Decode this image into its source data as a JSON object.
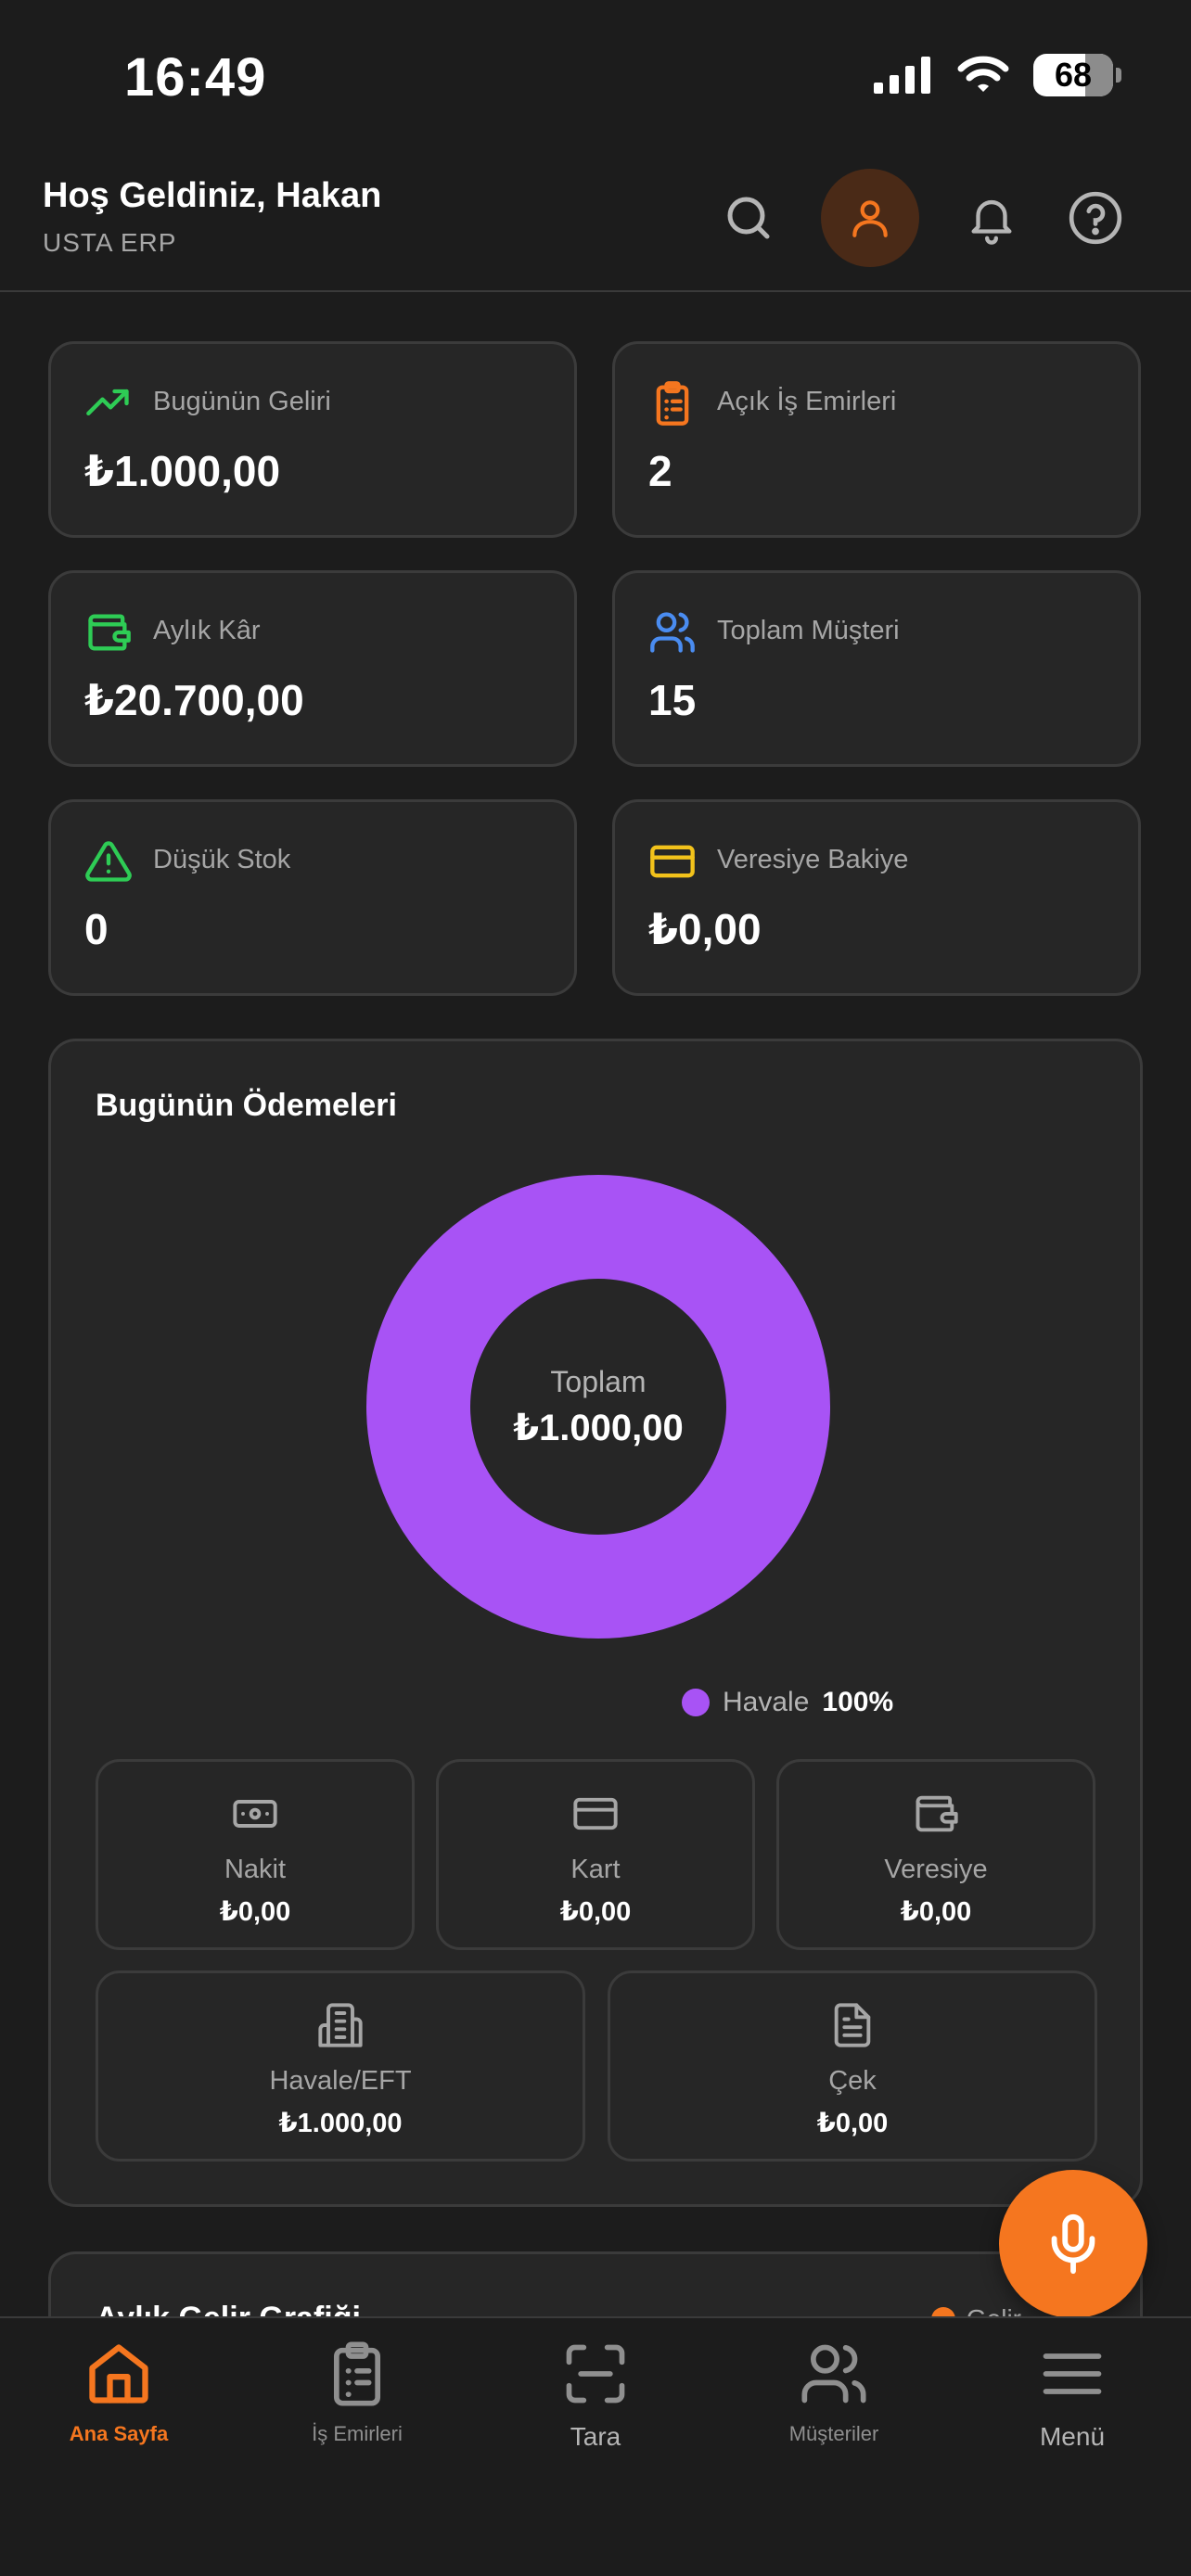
{
  "status_bar": {
    "time": "16:49",
    "battery": "68"
  },
  "header": {
    "greeting": "Hoş Geldiniz, Hakan",
    "company": "USTA ERP"
  },
  "stats": [
    {
      "label": "Bugünün Geliri",
      "value": "₺1.000,00",
      "icon": "trending-up-icon",
      "color": "#2ecc55"
    },
    {
      "label": "Açık İş Emirleri",
      "value": "2",
      "icon": "clipboard-list-icon",
      "color": "#f5761f"
    },
    {
      "label": "Aylık Kâr",
      "value": "₺20.700,00",
      "icon": "wallet-icon",
      "color": "#2ecc55"
    },
    {
      "label": "Toplam Müşteri",
      "value": "15",
      "icon": "users-icon",
      "color": "#4a8cf0"
    },
    {
      "label": "Düşük Stok",
      "value": "0",
      "icon": "alert-triangle-icon",
      "color": "#2ecc55"
    },
    {
      "label": "Veresiye Bakiye",
      "value": "₺0,00",
      "icon": "credit-card-icon",
      "color": "#f2c21b"
    }
  ],
  "payments": {
    "title": "Bugünün Ödemeleri",
    "total_label": "Toplam",
    "total_value": "₺1.000,00",
    "legend": {
      "name": "Havale",
      "percent": "100%",
      "color": "#a853f5"
    },
    "methods": [
      {
        "label": "Nakit",
        "value": "₺0,00",
        "icon": "banknote-icon"
      },
      {
        "label": "Kart",
        "value": "₺0,00",
        "icon": "credit-card-icon"
      },
      {
        "label": "Veresiye",
        "value": "₺0,00",
        "icon": "wallet-icon"
      },
      {
        "label": "Havale/EFT",
        "value": "₺1.000,00",
        "icon": "bank-building-icon"
      },
      {
        "label": "Çek",
        "value": "₺0,00",
        "icon": "document-icon"
      }
    ]
  },
  "chart_data": {
    "type": "pie",
    "categories": [
      "Havale"
    ],
    "values": [
      100
    ]
  },
  "next_card": {
    "title": "Aylık Gelir Grafiği",
    "legend": [
      {
        "name": "Gelir",
        "color": "#f5761f"
      },
      {
        "name": "",
        "color": "#2ecc55"
      }
    ]
  },
  "colors": {
    "accent": "#f5761f",
    "background": "#1c1c1c",
    "card": "#262626"
  },
  "bottom_nav": [
    {
      "label": "Ana Sayfa",
      "icon": "home-icon",
      "active": true
    },
    {
      "label": "İş Emirleri",
      "icon": "clipboard-icon",
      "active": false
    },
    {
      "label": "Tara",
      "icon": "scan-icon",
      "active": false
    },
    {
      "label": "Müşteriler",
      "icon": "users-icon",
      "active": false
    },
    {
      "label": "Menü",
      "icon": "menu-icon",
      "active": false
    }
  ]
}
